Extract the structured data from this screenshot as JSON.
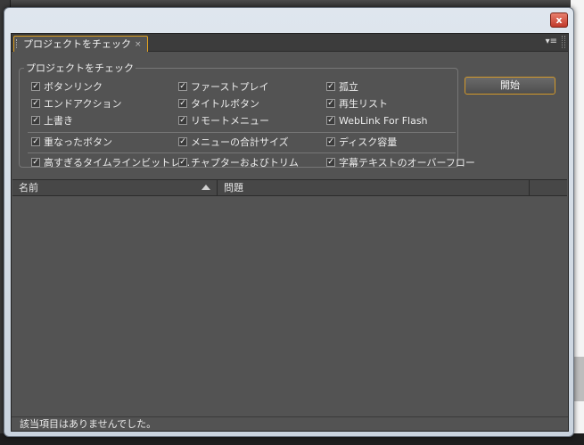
{
  "window": {
    "close_glyph": "x"
  },
  "panel": {
    "tab_label": "プロジェクトをチェック",
    "tab_close_glyph": "×",
    "menu_glyph": "▾≡"
  },
  "group": {
    "title": "プロジェクトをチェック",
    "checks": [
      {
        "label": "ボタンリンク",
        "checked": true
      },
      {
        "label": "ファーストプレイ",
        "checked": true
      },
      {
        "label": "孤立",
        "checked": true
      },
      {
        "label": "エンドアクション",
        "checked": true
      },
      {
        "label": "タイトルボタン",
        "checked": true
      },
      {
        "label": "再生リスト",
        "checked": true
      },
      {
        "label": "上書き",
        "checked": true
      },
      {
        "label": "リモートメニュー",
        "checked": true
      },
      {
        "label": "WebLink For Flash",
        "checked": true
      },
      {
        "label": "重なったボタン",
        "checked": true
      },
      {
        "label": "メニューの合計サイズ",
        "checked": true
      },
      {
        "label": "ディスク容量",
        "checked": true
      },
      {
        "label": "高すぎるタイムラインビットレ…",
        "checked": true
      },
      {
        "label": "チャプターおよびトリム",
        "checked": true
      },
      {
        "label": "字幕テキストのオーバーフロー",
        "checked": true
      }
    ]
  },
  "start_button": "開始",
  "table": {
    "columns": [
      "名前",
      "問題"
    ],
    "rows": []
  },
  "status": "該当項目はありませんでした。",
  "colors": {
    "accent": "#d49a2a",
    "panel_bg": "#535353"
  }
}
